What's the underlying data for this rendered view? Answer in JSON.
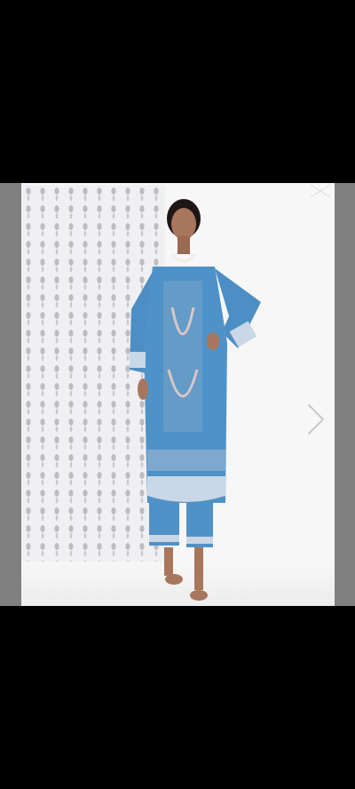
{
  "viewer": {
    "background_color": "#808080",
    "letterbox_color": "#000000",
    "controls": {
      "close_icon": "close-icon",
      "next_icon": "chevron-right-icon"
    }
  },
  "image": {
    "subject": "product-photo",
    "outfit_color": "#4d8fc4",
    "embroidery_color": "#d9c6c9"
  }
}
